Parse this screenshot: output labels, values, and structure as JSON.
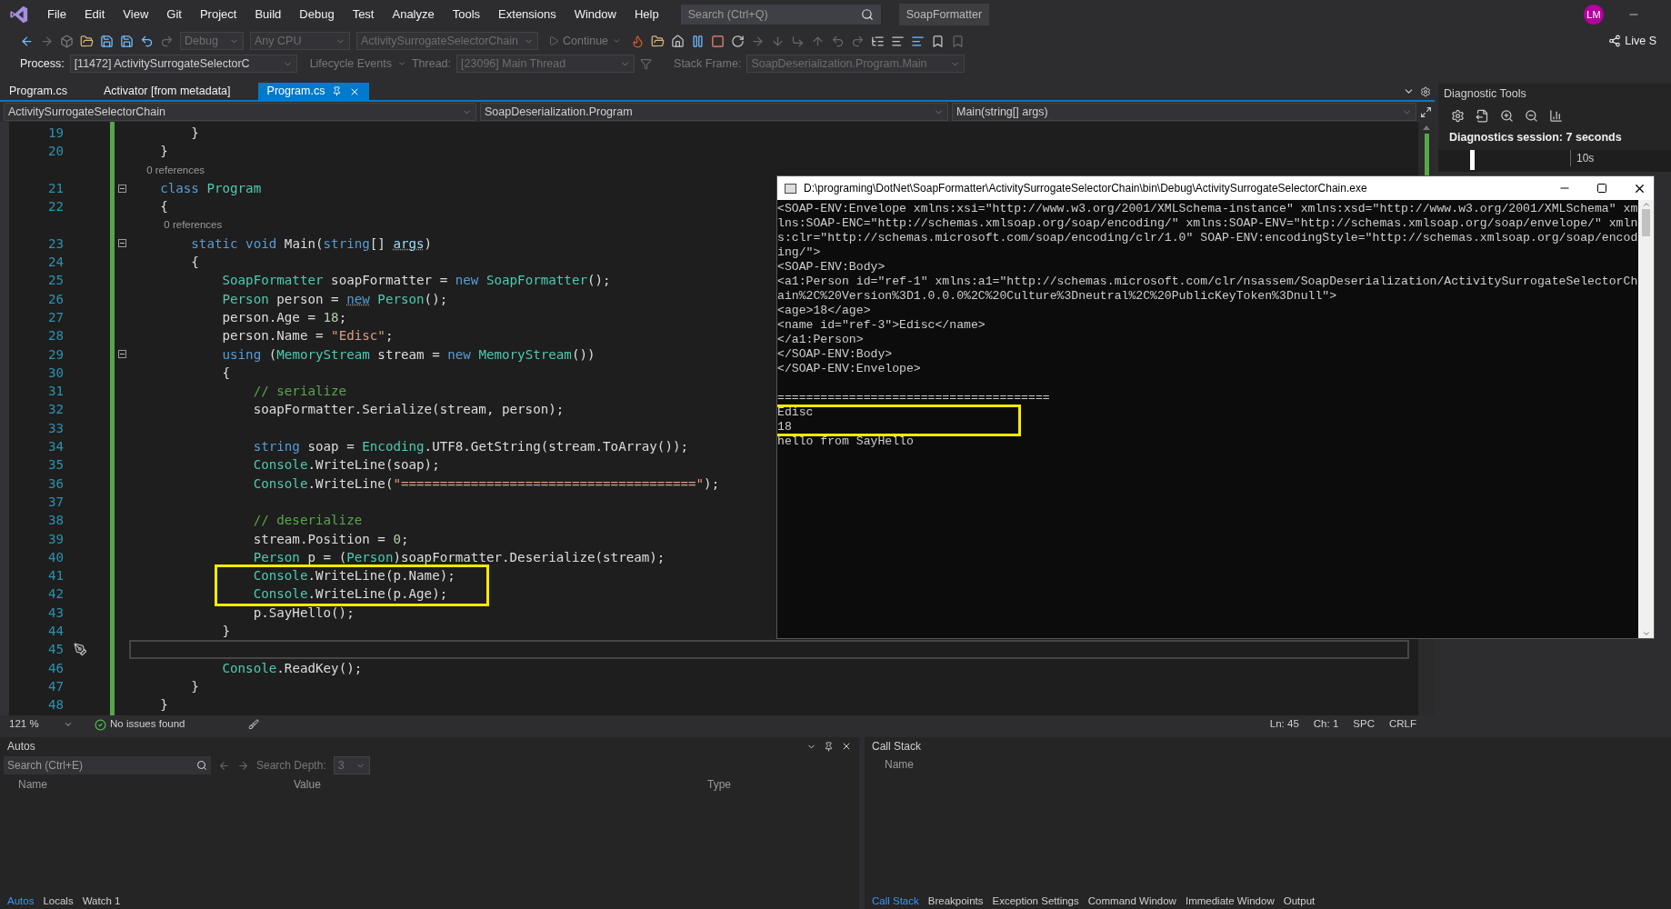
{
  "menu_bar": {
    "items": [
      "File",
      "Edit",
      "View",
      "Git",
      "Project",
      "Build",
      "Debug",
      "Test",
      "Analyze",
      "Tools",
      "Extensions",
      "Window",
      "Help"
    ],
    "search": {
      "placeholder": "Search (Ctrl+Q)"
    },
    "solution_name": "SoapFormatter",
    "avatar": "LM"
  },
  "toolbar": {
    "configuration": "Debug",
    "platform": "Any CPU",
    "startup_project": "ActivitySurrogateSelectorChain",
    "continue": "Continue",
    "live_share": "Live S"
  },
  "debug_location": {
    "process_label": "Process:",
    "process": "[11472] ActivitySurrogateSelectorC",
    "lifecycle": "Lifecycle Events",
    "thread_label": "Thread:",
    "thread": "[23096] Main Thread",
    "stack_frame_label": "Stack Frame:",
    "stack_frame": "SoapDeserialization.Program.Main"
  },
  "document_tabs": [
    {
      "label": "Program.cs",
      "selected": false
    },
    {
      "label": "Activator [from metadata]",
      "selected": false
    },
    {
      "label": "Program.cs",
      "selected": true
    }
  ],
  "navigation_bar": {
    "project": "ActivitySurrogateSelectorChain",
    "type": "SoapDeserialization.Program",
    "member": "Main(string[] args)"
  },
  "editor": {
    "lines": [
      {
        "kind": "code",
        "number": "19",
        "fold": false,
        "current": false,
        "tokens": [
          {
            "kind": "plain",
            "text": "        }"
          }
        ]
      },
      {
        "kind": "code",
        "number": "20",
        "fold": false,
        "current": false,
        "tokens": [
          {
            "kind": "plain",
            "text": "    }"
          }
        ]
      },
      {
        "kind": "codelens",
        "text": "    0 references"
      },
      {
        "kind": "code",
        "number": "21",
        "fold": true,
        "current": false,
        "tokens": [
          {
            "kind": "kw",
            "text": "    class"
          },
          {
            "kind": "type",
            "text": " Program"
          }
        ]
      },
      {
        "kind": "code",
        "number": "22",
        "fold": false,
        "current": false,
        "tokens": [
          {
            "kind": "plain",
            "text": "    {"
          }
        ]
      },
      {
        "kind": "codelens",
        "text": "        0 references"
      },
      {
        "kind": "code",
        "number": "23",
        "fold": true,
        "current": false,
        "tokens": [
          {
            "kind": "kw",
            "text": "        static void"
          },
          {
            "kind": "plain",
            "text": " Main("
          },
          {
            "kind": "kw",
            "text": "string"
          },
          {
            "kind": "plain",
            "text": "[] "
          },
          {
            "kind": "hint",
            "text": "args"
          },
          {
            "kind": "plain",
            "text": ")"
          }
        ]
      },
      {
        "kind": "code",
        "number": "24",
        "fold": false,
        "current": false,
        "tokens": [
          {
            "kind": "plain",
            "text": "        {"
          }
        ]
      },
      {
        "kind": "code",
        "number": "25",
        "fold": false,
        "current": false,
        "tokens": [
          {
            "kind": "type",
            "text": "            SoapFormatter"
          },
          {
            "kind": "plain",
            "text": " soapFormatter = "
          },
          {
            "kind": "kw",
            "text": "new"
          },
          {
            "kind": "type",
            "text": " SoapFormatter"
          },
          {
            "kind": "plain",
            "text": "();"
          }
        ]
      },
      {
        "kind": "code",
        "number": "26",
        "fold": false,
        "current": false,
        "tokens": [
          {
            "kind": "type",
            "text": "            Person"
          },
          {
            "kind": "plain",
            "text": " person = "
          },
          {
            "kind": "kw_hint",
            "text": "new"
          },
          {
            "kind": "type",
            "text": " Person"
          },
          {
            "kind": "plain",
            "text": "();"
          }
        ]
      },
      {
        "kind": "code",
        "number": "27",
        "fold": false,
        "current": false,
        "tokens": [
          {
            "kind": "plain",
            "text": "            person.Age = "
          },
          {
            "kind": "num",
            "text": "18"
          },
          {
            "kind": "plain",
            "text": ";"
          }
        ]
      },
      {
        "kind": "code",
        "number": "28",
        "fold": false,
        "current": false,
        "tokens": [
          {
            "kind": "plain",
            "text": "            person.Name = "
          },
          {
            "kind": "str",
            "text": "\"Edisc\""
          },
          {
            "kind": "plain",
            "text": ";"
          }
        ]
      },
      {
        "kind": "code",
        "number": "29",
        "fold": true,
        "current": false,
        "tokens": [
          {
            "kind": "kw",
            "text": "            using"
          },
          {
            "kind": "plain",
            "text": " ("
          },
          {
            "kind": "type",
            "text": "MemoryStream"
          },
          {
            "kind": "plain",
            "text": " stream = "
          },
          {
            "kind": "kw",
            "text": "new"
          },
          {
            "kind": "type",
            "text": " MemoryStream"
          },
          {
            "kind": "plain",
            "text": "())"
          }
        ]
      },
      {
        "kind": "code",
        "number": "30",
        "fold": false,
        "current": false,
        "tokens": [
          {
            "kind": "plain",
            "text": "            {"
          }
        ]
      },
      {
        "kind": "code",
        "number": "31",
        "fold": false,
        "current": false,
        "tokens": [
          {
            "kind": "com",
            "text": "                // serialize"
          }
        ]
      },
      {
        "kind": "code",
        "number": "32",
        "fold": false,
        "current": false,
        "tokens": [
          {
            "kind": "plain",
            "text": "                soapFormatter.Serialize(stream, person);"
          }
        ]
      },
      {
        "kind": "code",
        "number": "33",
        "fold": false,
        "current": false
      },
      {
        "kind": "code",
        "number": "34",
        "fold": false,
        "current": false,
        "tokens": [
          {
            "kind": "kw",
            "text": "                string"
          },
          {
            "kind": "plain",
            "text": " soap = "
          },
          {
            "kind": "type",
            "text": "Encoding"
          },
          {
            "kind": "plain",
            "text": ".UTF8.GetString(stream.ToArray());"
          }
        ]
      },
      {
        "kind": "code",
        "number": "35",
        "fold": false,
        "current": false,
        "tokens": [
          {
            "kind": "type",
            "text": "                Console"
          },
          {
            "kind": "plain",
            "text": ".WriteLine(soap);"
          }
        ]
      },
      {
        "kind": "code",
        "number": "36",
        "fold": false,
        "current": false,
        "tokens": [
          {
            "kind": "type",
            "text": "                Console"
          },
          {
            "kind": "plain",
            "text": ".WriteLine("
          },
          {
            "kind": "str",
            "text": "\"======================================\""
          },
          {
            "kind": "plain",
            "text": ");"
          }
        ]
      },
      {
        "kind": "code",
        "number": "37",
        "fold": false,
        "current": false
      },
      {
        "kind": "code",
        "number": "38",
        "fold": false,
        "current": false,
        "tokens": [
          {
            "kind": "com",
            "text": "                // deserialize"
          }
        ]
      },
      {
        "kind": "code",
        "number": "39",
        "fold": false,
        "current": false,
        "tokens": [
          {
            "kind": "plain",
            "text": "                stream.Position = "
          },
          {
            "kind": "num",
            "text": "0"
          },
          {
            "kind": "plain",
            "text": ";"
          }
        ]
      },
      {
        "kind": "code",
        "number": "40",
        "fold": false,
        "current": false,
        "tokens": [
          {
            "kind": "type",
            "text": "                Person"
          },
          {
            "kind": "plain",
            "text": " p = ("
          },
          {
            "kind": "type",
            "text": "Person"
          },
          {
            "kind": "plain",
            "text": ")soapFormatter.Deserialize(stream);"
          }
        ]
      },
      {
        "kind": "code",
        "number": "41",
        "fold": false,
        "current": false,
        "tokens": [
          {
            "kind": "type",
            "text": "                Console"
          },
          {
            "kind": "plain",
            "text": ".WriteLine(p.Name);"
          }
        ]
      },
      {
        "kind": "code",
        "number": "42",
        "fold": false,
        "current": false,
        "tokens": [
          {
            "kind": "type",
            "text": "                Console"
          },
          {
            "kind": "plain",
            "text": ".WriteLine(p.Age);"
          }
        ]
      },
      {
        "kind": "code",
        "number": "43",
        "fold": false,
        "current": false,
        "tokens": [
          {
            "kind": "plain",
            "text": "                p.SayHello();"
          }
        ]
      },
      {
        "kind": "code",
        "number": "44",
        "fold": false,
        "current": false,
        "tokens": [
          {
            "kind": "plain",
            "text": "            }"
          }
        ]
      },
      {
        "kind": "code",
        "number": "45",
        "fold": false,
        "current": true
      },
      {
        "kind": "code",
        "number": "46",
        "fold": false,
        "current": false,
        "tokens": [
          {
            "kind": "type",
            "text": "            Console"
          },
          {
            "kind": "plain",
            "text": ".ReadKey();"
          }
        ]
      },
      {
        "kind": "code",
        "number": "47",
        "fold": false,
        "current": false,
        "tokens": [
          {
            "kind": "plain",
            "text": "        }"
          }
        ]
      },
      {
        "kind": "code",
        "number": "48",
        "fold": false,
        "current": false,
        "tokens": [
          {
            "kind": "plain",
            "text": "    }"
          }
        ]
      }
    ]
  },
  "console_window": {
    "title": "D:\\programing\\DotNet\\SoapFormatter\\ActivitySurrogateSelectorChain\\bin\\Debug\\ActivitySurrogateSelectorChain.exe",
    "blocks": [
      [
        "<SOAP-ENV:Envelope xmlns:xsi=\"http://www.w3.org/2001/XMLSchema-instance\" xmlns:xsd=\"http://www.w3.org/2001/XMLSchema\" xm",
        "lns:SOAP-ENC=\"http://schemas.xmlsoap.org/soap/encoding/\" xmlns:SOAP-ENV=\"http://schemas.xmlsoap.org/soap/envelope/\" xmln",
        "s:clr=\"http://schemas.microsoft.com/soap/encoding/clr/1.0\" SOAP-ENV:encodingStyle=\"http://schemas.xmlsoap.org/soap/encod",
        "ing/\">",
        "<SOAP-ENV:Body>",
        "<a1:Person id=\"ref-1\" xmlns:a1=\"http://schemas.microsoft.com/clr/nsassem/SoapDeserialization/ActivitySurrogateSelectorCh",
        "ain%2C%20Version%3D1.0.0.0%2C%20Culture%3Dneutral%2C%20PublicKeyToken%3Dnull\">",
        "<age>18</age>",
        "<name id=\"ref-3\">Edisc</name>",
        "</a1:Person>",
        "</SOAP-ENV:Body>",
        "</SOAP-ENV:Envelope>"
      ],
      [
        "======================================",
        "Edisc",
        "18",
        "hello from SayHello"
      ]
    ]
  },
  "status_bar": {
    "zoom": "121 %",
    "issues": "No issues found",
    "line": "Ln: 45",
    "column": "Ch: 1",
    "whitespace": "SPC",
    "line_ending": "CRLF"
  },
  "diagnostic_tools": {
    "title": "Diagnostic Tools",
    "session": "Diagnostics session: 7 seconds",
    "timeline_label": "10s"
  },
  "autos_panel": {
    "title": "Autos",
    "search": {
      "placeholder": "Search (Ctrl+E)"
    },
    "search_depth_label": "Search Depth:",
    "search_depth": "3",
    "columns": [
      "Name",
      "Value",
      "Type"
    ],
    "tabs": [
      {
        "label": "Autos",
        "selected": true
      },
      {
        "label": "Locals",
        "selected": false
      },
      {
        "label": "Watch 1",
        "selected": false
      }
    ]
  },
  "call_stack_panel": {
    "title": "Call Stack",
    "columns": [
      "Name"
    ],
    "tabs": [
      {
        "label": "Call Stack",
        "selected": true
      },
      {
        "label": "Breakpoints",
        "selected": false
      },
      {
        "label": "Exception Settings",
        "selected": false
      },
      {
        "label": "Command Window",
        "selected": false
      },
      {
        "label": "Immediate Window",
        "selected": false
      },
      {
        "label": "Output",
        "selected": false
      }
    ]
  }
}
